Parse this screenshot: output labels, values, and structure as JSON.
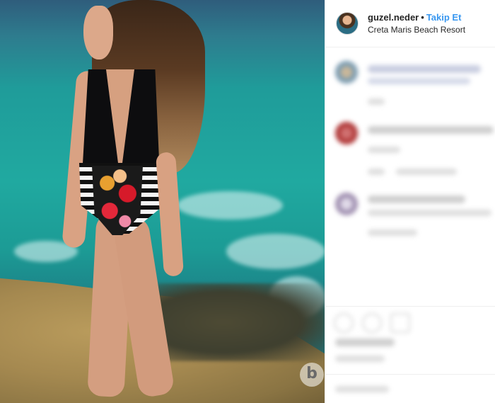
{
  "post": {
    "username": "guzel.neder",
    "separator": "•",
    "follow_label": "Takip Et",
    "location": "Creta Maris Beach Resort",
    "watermark": "b"
  },
  "colors": {
    "follow_blue": "#3897f0",
    "text_primary": "#262626"
  },
  "icons": [
    "avatar",
    "like-icon",
    "comment-icon",
    "share-icon"
  ]
}
